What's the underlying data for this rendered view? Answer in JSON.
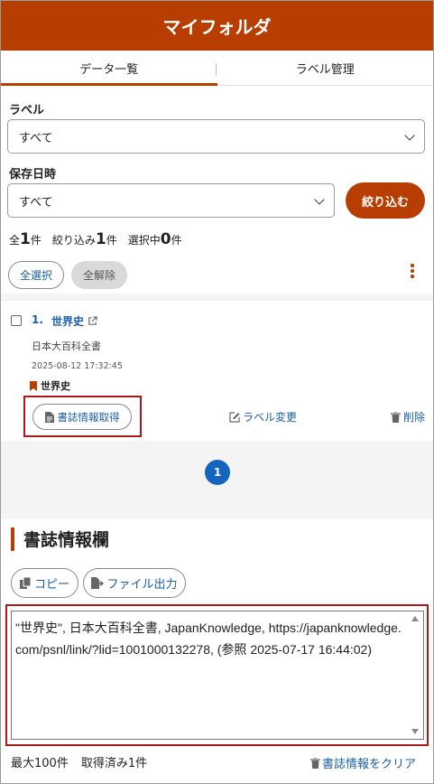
{
  "header": {
    "title": "マイフォルダ"
  },
  "tabs": [
    {
      "label": "データ一覧",
      "active": true
    },
    {
      "label": "ラベル管理",
      "active": false
    }
  ],
  "filters": {
    "label_title": "ラベル",
    "label_value": "すべて",
    "date_title": "保存日時",
    "date_value": "すべて",
    "filter_button": "絞り込む"
  },
  "counts": {
    "total_prefix": "全",
    "total": "1",
    "total_suffix": "件",
    "filtered_prefix": "絞り込み",
    "filtered": "1",
    "filtered_suffix": "件",
    "selected_prefix": "選択中",
    "selected": "0",
    "selected_suffix": "件"
  },
  "selection": {
    "select_all": "全選択",
    "deselect_all": "全解除"
  },
  "items": [
    {
      "number": "1.",
      "title": "世界史",
      "source": "日本大百科全書",
      "date": "2025-08-12 17:32:45",
      "label": "世界史",
      "biblio_button": "書誌情報取得",
      "label_change": "ラベル変更",
      "delete": "削除"
    }
  ],
  "pagination": {
    "current": "1"
  },
  "biblio": {
    "title": "書誌情報欄",
    "copy_button": "コピー",
    "export_button": "ファイル出力",
    "text": "\"世界史\", 日本大百科全書, JapanKnowledge, https://japanknowledge.com/psnl/link/?lid=1001000132278, (参照 2025-07-17 16:44:02)",
    "max_label": "最大100件",
    "acquired_label": "取得済み1件",
    "clear_button": "書誌情報をクリア"
  },
  "colors": {
    "brand": "#b73e00",
    "link": "#1a5fa8",
    "highlight": "#b01717",
    "page": "#1565c0"
  }
}
